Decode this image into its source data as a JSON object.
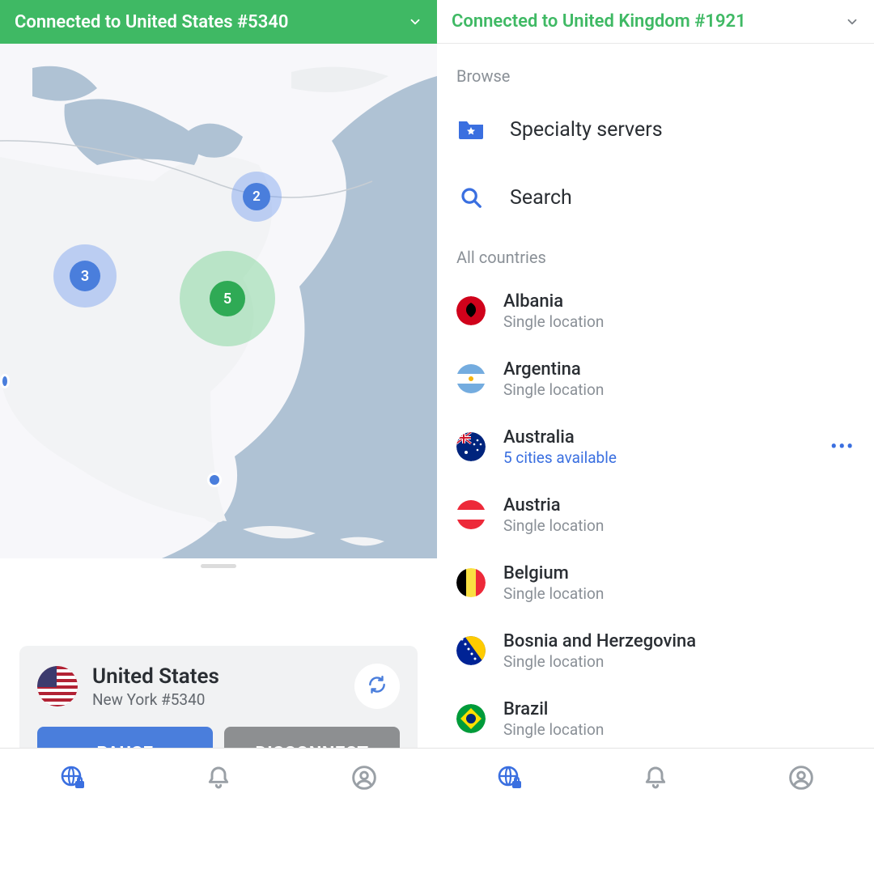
{
  "left": {
    "status": "Connected to United States #5340",
    "connection": {
      "country": "United States",
      "server": "New York #5340",
      "pause_label": "PAUSE",
      "disconnect_label": "DISCONNECT"
    },
    "map_markers": {
      "m1": "2",
      "m2": "3",
      "m3": "5"
    }
  },
  "right": {
    "status": "Connected to United Kingdom #1921",
    "browse_label": "Browse",
    "specialty_label": "Specialty servers",
    "search_label": "Search",
    "all_countries_label": "All countries",
    "countries": {
      "albania": {
        "name": "Albania",
        "sub": "Single location"
      },
      "argentina": {
        "name": "Argentina",
        "sub": "Single location"
      },
      "australia": {
        "name": "Australia",
        "sub": "5 cities available"
      },
      "austria": {
        "name": "Austria",
        "sub": "Single location"
      },
      "belgium": {
        "name": "Belgium",
        "sub": "Single location"
      },
      "bosnia": {
        "name": "Bosnia and Herzegovina",
        "sub": "Single location"
      },
      "brazil": {
        "name": "Brazil",
        "sub": "Single location"
      }
    }
  }
}
